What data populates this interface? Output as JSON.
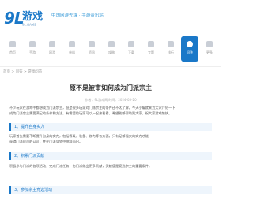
{
  "header": {
    "logo_number": "9L",
    "logo_text": "游戏",
    "logo_sub": "9L.GAME",
    "slogan": "中国网游先锋 · 手游资讯站"
  },
  "nav": {
    "items": [
      {
        "label": "首页"
      },
      {
        "label": "手游"
      },
      {
        "label": "网游"
      },
      {
        "label": "单机"
      },
      {
        "label": "资讯"
      },
      {
        "label": "攻略"
      },
      {
        "label": "下载"
      },
      {
        "label": "专题"
      },
      {
        "label": "排行"
      },
      {
        "label": "问答"
      },
      {
        "label": "更多"
      }
    ],
    "active_index": 9
  },
  "breadcrumb": "首页 > 问答 > 游戏问答",
  "article": {
    "title": "原不是被审如何成为门派宗主",
    "meta": "作者：9L游戏网  时间：2024-05-20",
    "intro": [
      "不少玩家在游戏中都想成为门派宗主，但是很多玩家对门派宗主的条件还不太了解，今天小编就来为大家介绍一下",
      "成为门派宗主需要满足的条件和方法，有需要的玩家可以一起来看看，希望能够帮助到大家，祝大家游戏愉快。"
    ],
    "sections": [
      {
        "heading": "1、提升自身实力",
        "body": [
          "玩家首先需要不断提升自身的实力，包括等级、装备、修为等各方面，只有足够强大的实力才能",
          "获得门派成员的认可，并在门派竞争中脱颖而出。"
        ]
      },
      {
        "heading": "2、积累门派贡献",
        "body": [
          "积极参与门派的各项活动，完成门派任务，为门派做出更多贡献，贡献值是竞选宗主的重要条件。"
        ]
      },
      {
        "heading": "3、参加宗主竞选活动",
        "body": []
      }
    ]
  }
}
